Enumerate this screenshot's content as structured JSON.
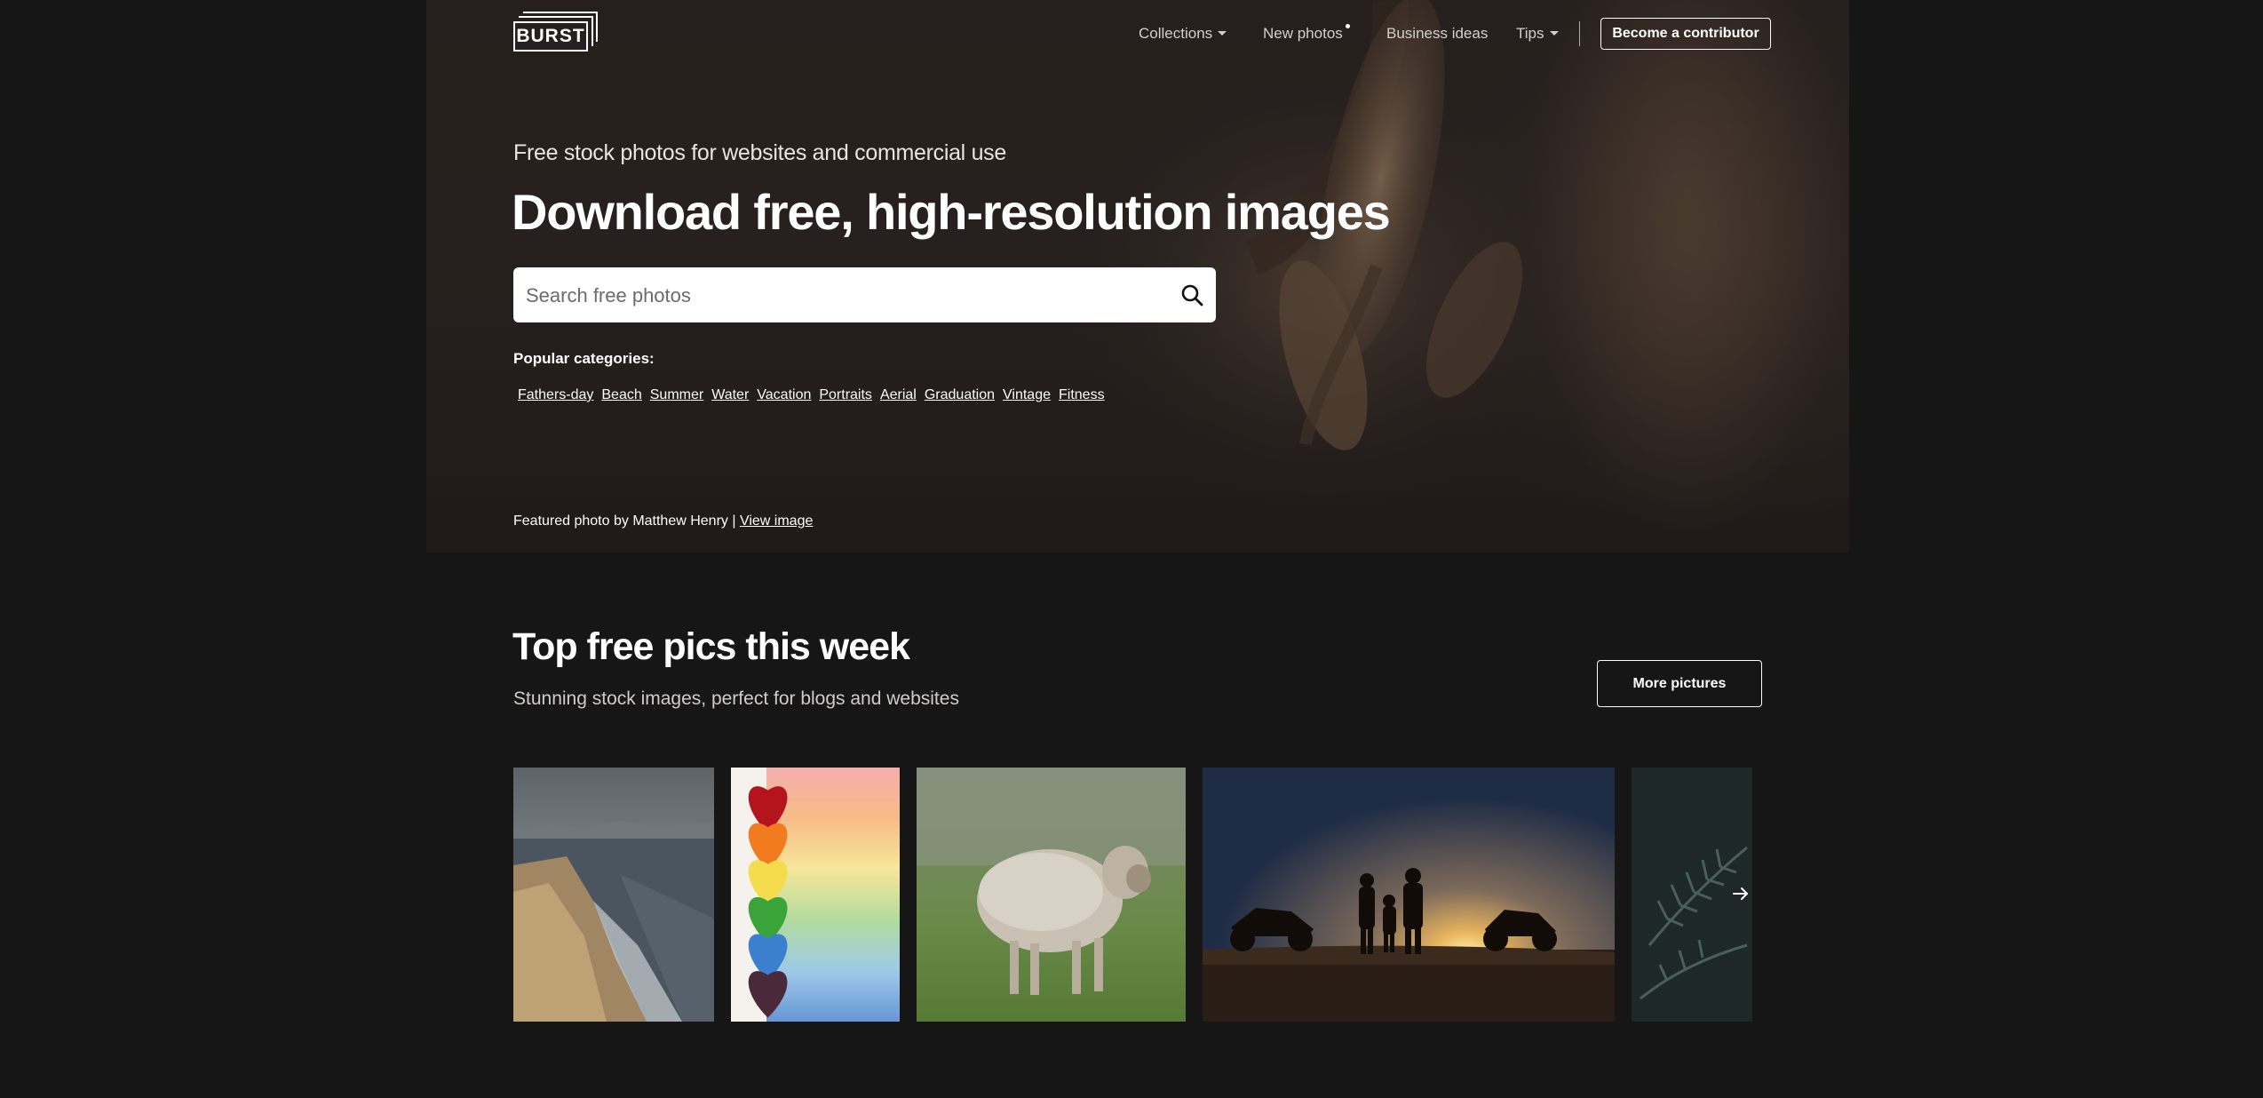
{
  "logo": {
    "text": "BURST"
  },
  "nav": {
    "items": [
      {
        "label": "Collections",
        "dropdown": true
      },
      {
        "label": "New photos",
        "dropdown": false,
        "dot": true
      },
      {
        "label": "Business ideas",
        "dropdown": false
      },
      {
        "label": "Tips",
        "dropdown": true
      }
    ],
    "cta": "Become a contributor"
  },
  "hero": {
    "tagline": "Free stock photos for websites and commercial use",
    "headline": "Download free, high-resolution images",
    "search": {
      "placeholder": "Search free photos",
      "icon": "search-icon"
    },
    "popular_label": "Popular categories:",
    "categories": [
      "Fathers-day",
      "Beach",
      "Summer",
      "Water",
      "Vacation",
      "Portraits",
      "Aerial",
      "Graduation",
      "Vintage",
      "Fitness"
    ],
    "featured_prefix": "Featured photo by Matthew Henry | ",
    "featured_link": "View image"
  },
  "top": {
    "title": "Top free pics this week",
    "subtitle": "Stunning stock images, perfect for blogs and websites",
    "more_button": "More pictures",
    "photos": [
      "coastline-photo",
      "rainbow-hearts-photo",
      "sheep-photo",
      "family-sunset-atv-photo",
      "fern-photo"
    ],
    "next_icon": "chevron-right-icon"
  },
  "colors": {
    "background": "#161616",
    "hero": "#2a2320",
    "text": "#ffffff"
  }
}
